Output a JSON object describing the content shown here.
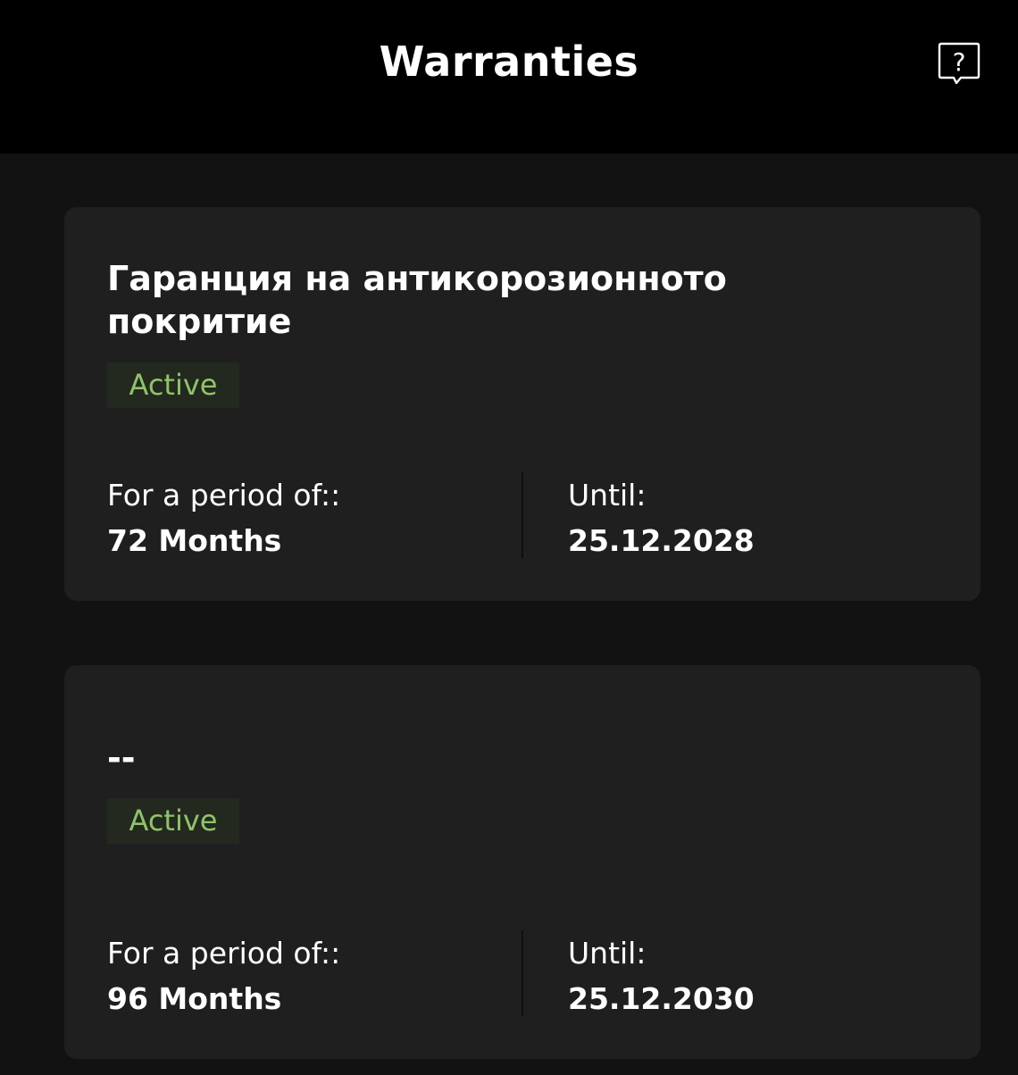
{
  "header": {
    "title": "Warranties",
    "help_icon": "help-question-icon"
  },
  "colors": {
    "header_background": "#000000",
    "page_background": "#121212",
    "card_background": "#1f1f1f",
    "badge_background": "#24291f",
    "badge_text": "#8fc46a"
  },
  "warranties": [
    {
      "title": "Гаранция на антикорозионното покритие",
      "status": "Active",
      "period_label": "For a period of::",
      "period_value": "72 Months",
      "until_label": "Until:",
      "until_value": "25.12.2028"
    },
    {
      "title": "--",
      "status": "Active",
      "period_label": "For a period of::",
      "period_value": "96 Months",
      "until_label": "Until:",
      "until_value": "25.12.2030"
    }
  ]
}
